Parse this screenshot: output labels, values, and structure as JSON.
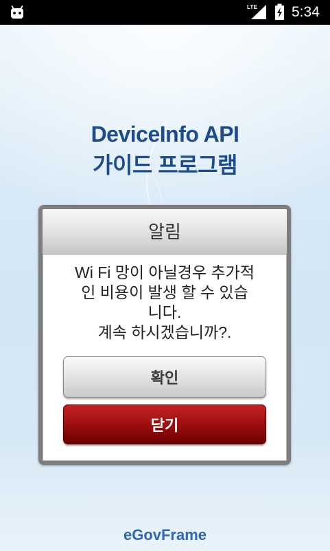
{
  "status_bar": {
    "network_label": "LTE",
    "time": "5:34",
    "icons": {
      "notification": "android-icon",
      "signal": "signal-icon",
      "battery": "battery-charging-icon"
    }
  },
  "header": {
    "title_line1": "DeviceInfo API",
    "title_line2": "가이드 프로그램"
  },
  "dialog": {
    "title": "알림",
    "message_lines": [
      "Wi Fi 망이 아닐경우 추가적",
      "인 비용이 발생 할 수 있습",
      "니다.",
      "계속 하시겠습니까?."
    ],
    "confirm_label": "확인",
    "close_label": "닫기"
  },
  "footer": {
    "brand": "eGovFrame"
  },
  "colors": {
    "title": "#1d4b8f",
    "background": "#dcebf6",
    "confirm_button": "#d8d8d8",
    "close_button": "#9e0f0f",
    "brand": "#2f66b5"
  }
}
